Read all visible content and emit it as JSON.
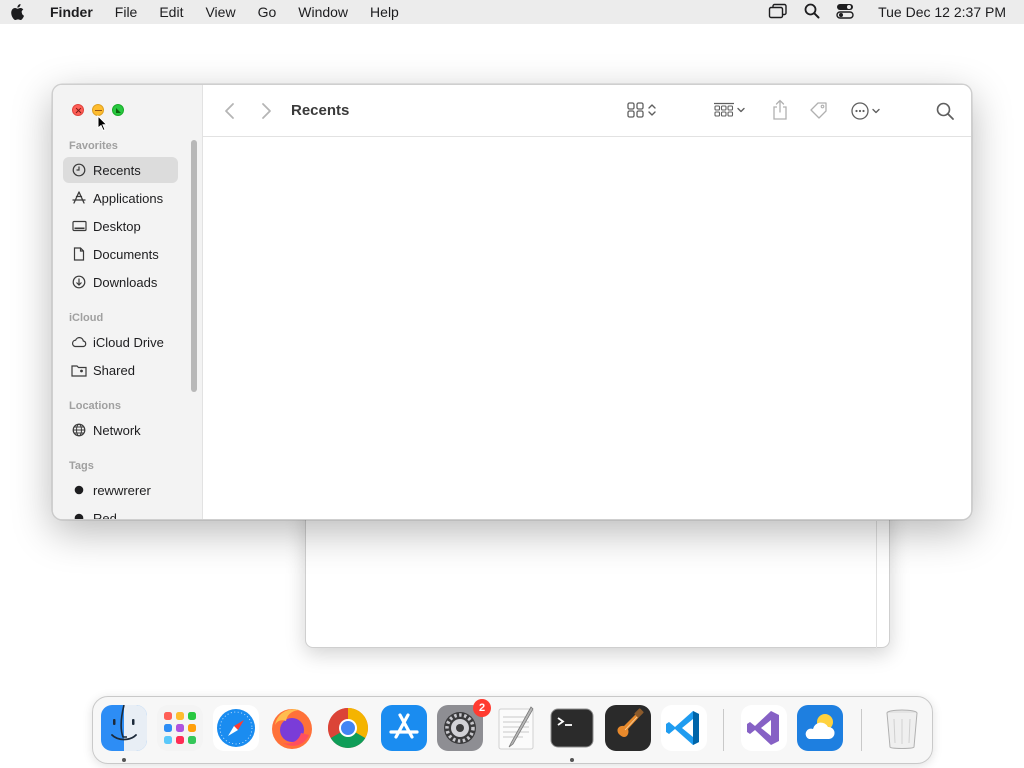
{
  "menubar": {
    "app_name": "Finder",
    "items": [
      "File",
      "Edit",
      "View",
      "Go",
      "Window",
      "Help"
    ],
    "clock": "Tue Dec 12  2:37 PM",
    "status_icons": [
      "screen-mirroring-icon",
      "spotlight-icon",
      "control-center-icon"
    ]
  },
  "finder": {
    "title": "Recents",
    "sidebar": {
      "sections": [
        {
          "label": "Favorites",
          "items": [
            {
              "label": "Recents",
              "icon": "clock-icon",
              "selected": true
            },
            {
              "label": "Applications",
              "icon": "applications-icon"
            },
            {
              "label": "Desktop",
              "icon": "desktop-icon"
            },
            {
              "label": "Documents",
              "icon": "document-icon"
            },
            {
              "label": "Downloads",
              "icon": "download-icon"
            }
          ]
        },
        {
          "label": "iCloud",
          "items": [
            {
              "label": "iCloud Drive",
              "icon": "cloud-icon"
            },
            {
              "label": "Shared",
              "icon": "shared-folder-icon"
            }
          ]
        },
        {
          "label": "Locations",
          "items": [
            {
              "label": "Network",
              "icon": "globe-icon"
            }
          ]
        },
        {
          "label": "Tags",
          "items": [
            {
              "label": "rewwrerer",
              "icon": "tag-dot-icon",
              "color": "#1d1d1f"
            },
            {
              "label": "Red",
              "icon": "tag-dot-icon",
              "color": "#1d1d1f"
            }
          ]
        }
      ]
    }
  },
  "dock": {
    "apps": [
      {
        "name": "Finder",
        "icon": "finder-icon",
        "running": true
      },
      {
        "name": "Launchpad",
        "icon": "launchpad-icon"
      },
      {
        "name": "Safari",
        "icon": "safari-icon"
      },
      {
        "name": "Firefox",
        "icon": "firefox-icon"
      },
      {
        "name": "Chrome",
        "icon": "chrome-icon"
      },
      {
        "name": "App Store",
        "icon": "app-store-icon"
      },
      {
        "name": "System Settings",
        "icon": "settings-icon",
        "badge": "2"
      },
      {
        "name": "TextEdit",
        "icon": "textedit-icon"
      },
      {
        "name": "Terminal",
        "icon": "terminal-icon",
        "running": true
      },
      {
        "name": "GarageBand",
        "icon": "garageband-icon"
      },
      {
        "name": "VS Code",
        "icon": "vscode-icon"
      },
      {
        "name": "Visual Studio",
        "icon": "visual-studio-icon"
      },
      {
        "name": "Weather",
        "icon": "weather-icon"
      },
      {
        "name": "Trash",
        "icon": "trash-icon"
      }
    ]
  }
}
